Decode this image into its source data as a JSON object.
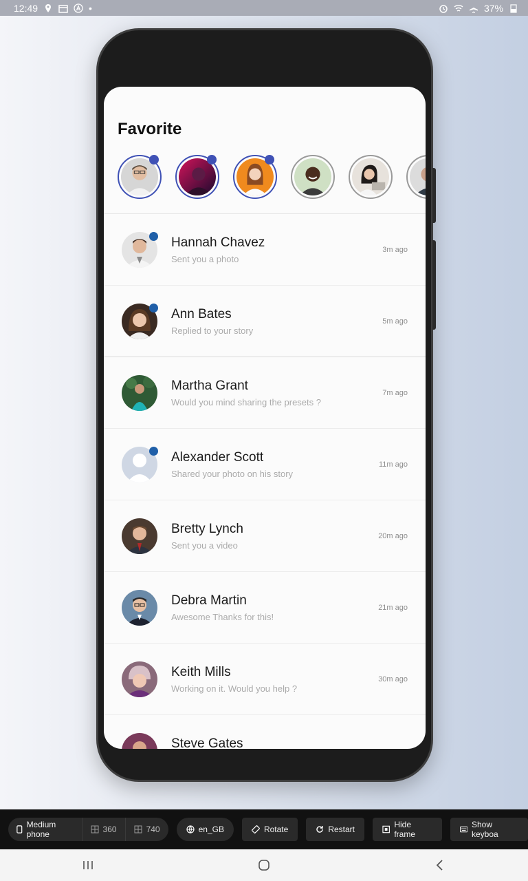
{
  "status_bar": {
    "time": "12:49",
    "battery": "37%"
  },
  "screen": {
    "title": "Favorite",
    "favorites": [
      {
        "name": "story-1",
        "online": true
      },
      {
        "name": "story-2",
        "online": true
      },
      {
        "name": "story-3",
        "online": true
      },
      {
        "name": "story-4",
        "online": false
      },
      {
        "name": "story-5",
        "online": false
      },
      {
        "name": "story-6",
        "online": false
      }
    ],
    "chats": [
      {
        "name": "Hannah Chavez",
        "message": "Sent you a photo",
        "time": "3m ago",
        "online": true
      },
      {
        "name": "Ann Bates",
        "message": "Replied to your story",
        "time": "5m ago",
        "online": true
      },
      {
        "name": "Martha Grant",
        "message": "Would you mind sharing the presets ?",
        "time": "7m ago",
        "online": false
      },
      {
        "name": "Alexander Scott",
        "message": "Shared your photo on his story",
        "time": "11m ago",
        "online": true
      },
      {
        "name": "Bretty Lynch",
        "message": "Sent you a video",
        "time": "20m ago",
        "online": false
      },
      {
        "name": "Debra Martin",
        "message": "Awesome Thanks for this!",
        "time": "21m ago",
        "online": false
      },
      {
        "name": "Keith Mills",
        "message": "Working on it. Would you help ?",
        "time": "30m ago",
        "online": false
      },
      {
        "name": "Steve Gates",
        "message": "",
        "time": "",
        "online": false
      }
    ]
  },
  "toolbar": {
    "device": "Medium phone",
    "width": "360",
    "height": "740",
    "locale": "en_GB",
    "rotate": "Rotate",
    "restart": "Restart",
    "hide_frame": "Hide frame",
    "show_keyboard": "Show keyboa"
  },
  "colors": {
    "accent": "#3f51b5",
    "online_dot": "#1f5fa8"
  }
}
